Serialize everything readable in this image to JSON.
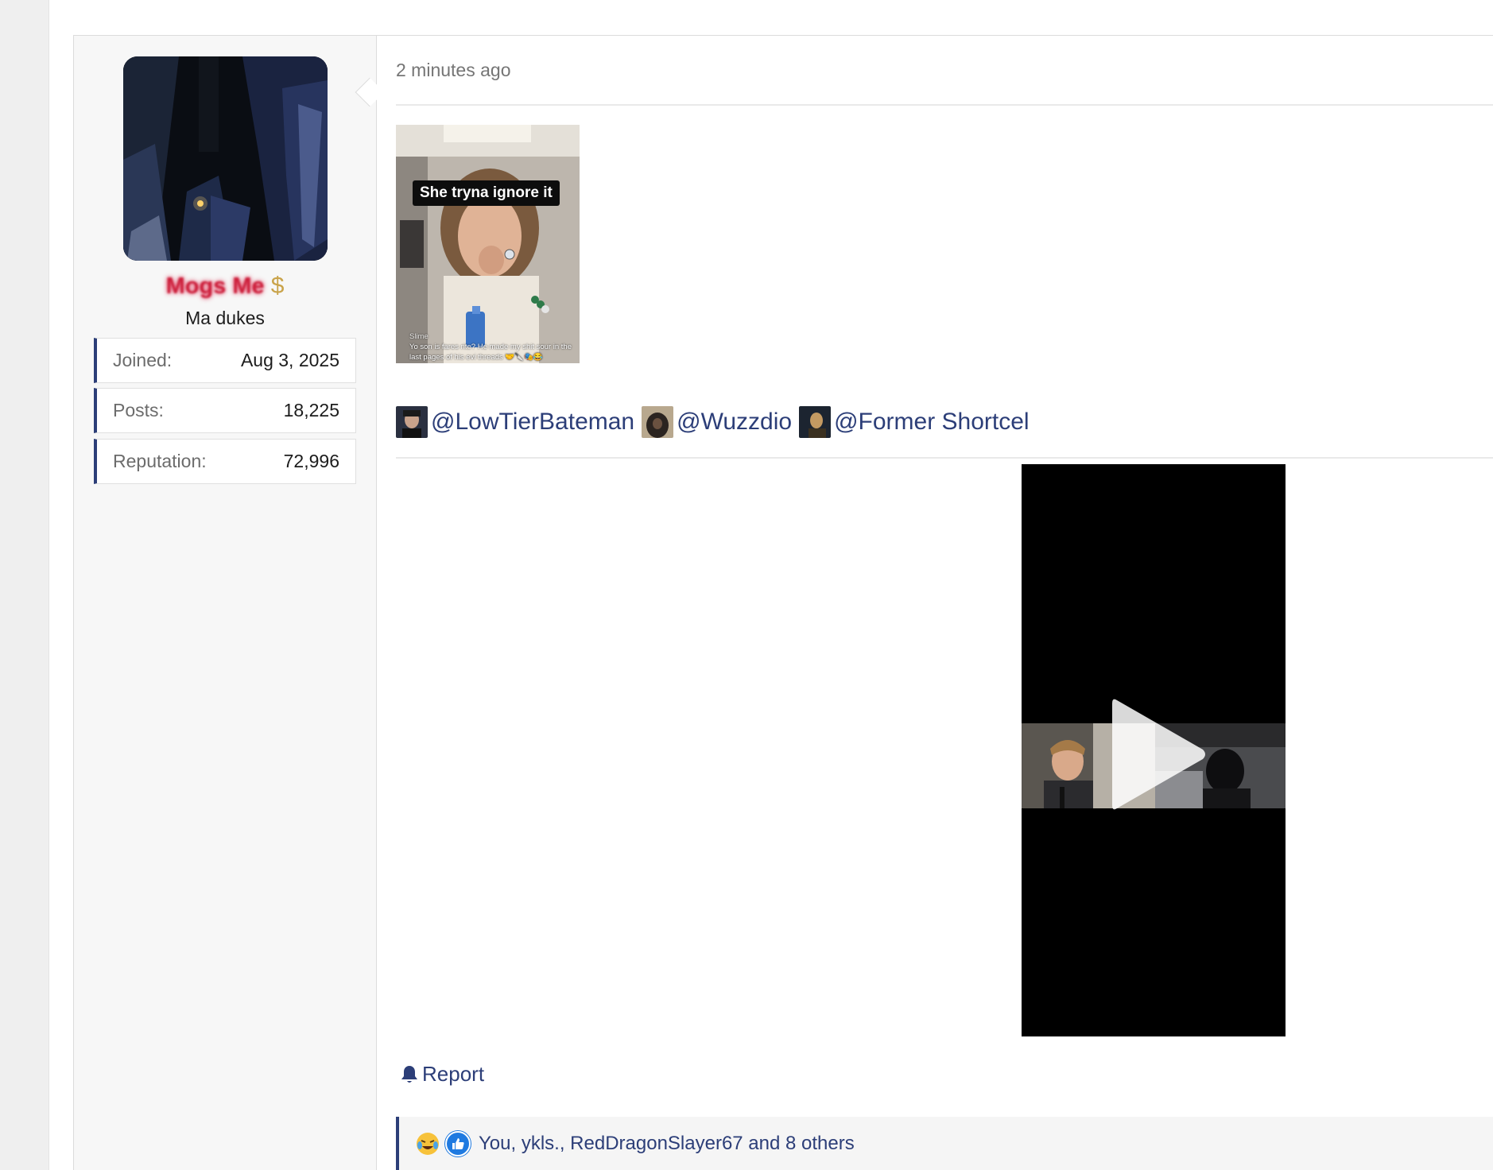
{
  "post": {
    "timestamp": "2 minutes ago",
    "meme": {
      "caption": "She tryna ignore it",
      "comment_author": "Slime",
      "comment_text": "Yo son is fares rite? He made my shit sour in the last pages of his evi threads 🤝🔪🎭😂"
    },
    "mentions": [
      "@LowTierBateman",
      "@Wuzzdio",
      "@Former Shortcel"
    ],
    "report_label": "Report",
    "reactions_text": "You, ykls., RedDragonSlayer67 and 8 others"
  },
  "user": {
    "username": "Mogs Me",
    "username_icon": "dollar-icon",
    "title": "Ma dukes",
    "stats": [
      {
        "label": "Joined:",
        "value": "Aug 3, 2025"
      },
      {
        "label": "Posts:",
        "value": "18,225"
      },
      {
        "label": "Reputation:",
        "value": "72,996"
      }
    ]
  },
  "colors": {
    "accent": "#2c3e78",
    "username": "#cc1f3b",
    "dollar": "#c9a34a"
  }
}
